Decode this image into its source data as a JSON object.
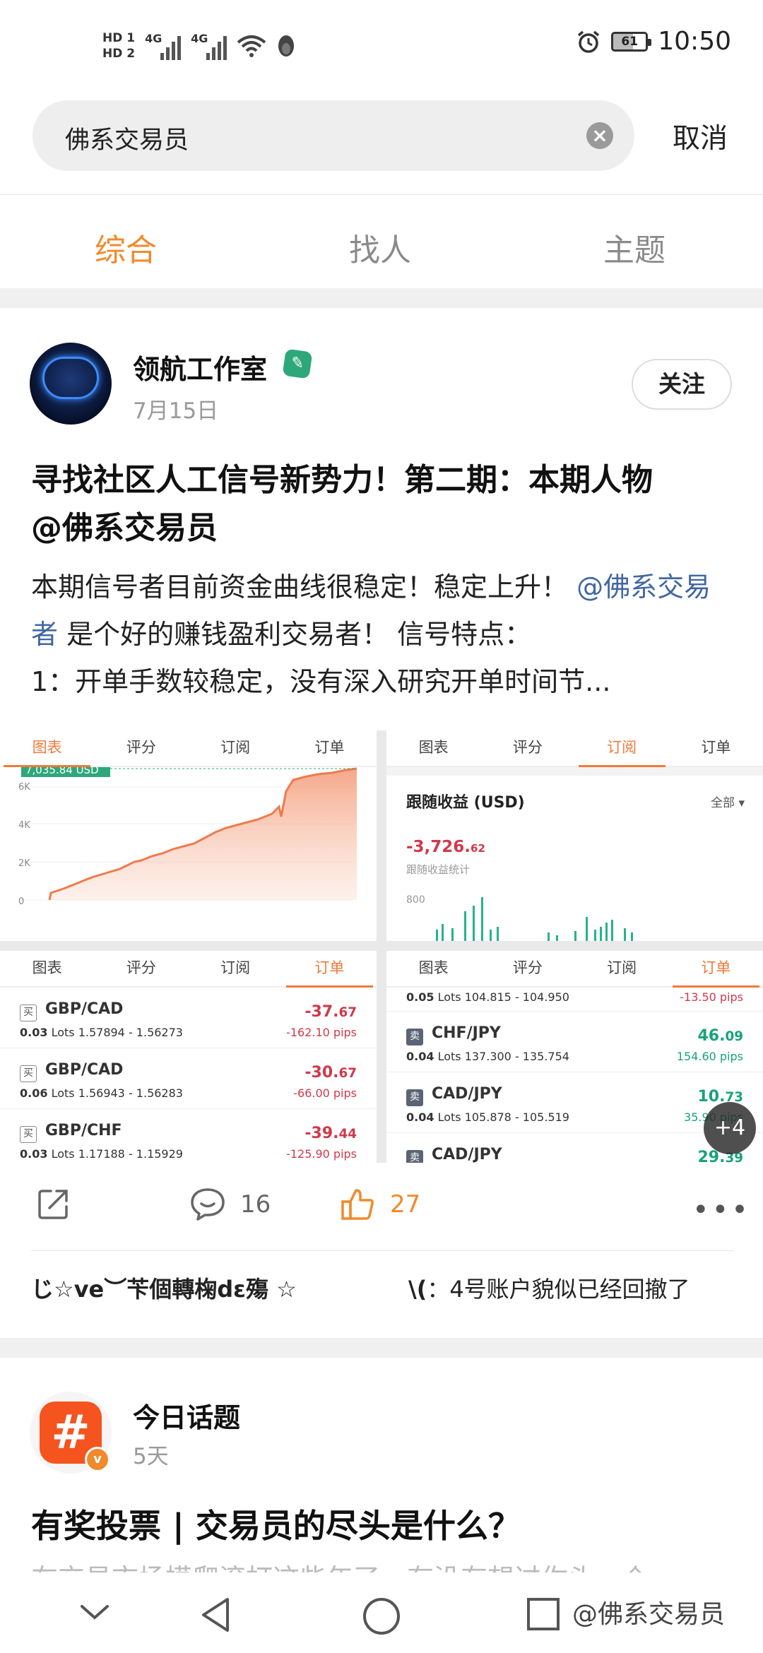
{
  "status_bar": {
    "hd1": "HD 1",
    "hd2": "HD 2",
    "net1": "4G",
    "net2": "4G",
    "battery": "61",
    "time": "10:50"
  },
  "search": {
    "query": "佛系交易员",
    "cancel_label": "取消"
  },
  "tabs": [
    {
      "label": "综合",
      "active": true
    },
    {
      "label": "找人",
      "active": false
    },
    {
      "label": "主题",
      "active": false
    }
  ],
  "post1": {
    "author": "领航工作室",
    "date": "7月15日",
    "follow_label": "关注",
    "title_line1": "寻找社区人工信号新势力！第二期：本期人物",
    "title_line2": "@佛系交易员",
    "body_part1": "本期信号者目前资金曲线很稳定！稳定上升！ ",
    "mention": "@佛系交易者",
    "body_part2": " 是个好的赚钱盈利交易者！ 信号特点：",
    "body_line3": "1：开单手数较稳定，没有深入研究开单时间节...",
    "images": {
      "mini_tabs": [
        "图表",
        "评分",
        "订阅",
        "订单"
      ],
      "chart_tag": "7,035.84 USD",
      "chart_yticks": [
        "6K",
        "4K",
        "2K",
        "0"
      ],
      "follow_title": "跟随收益 (USD)",
      "follow_filter": "全部 ▾",
      "follow_value": "-3,726.",
      "follow_value_dec": "62",
      "follow_sub": "跟随收益统计",
      "follow_ylabel": "800",
      "orders_left": [
        {
          "side": "买",
          "pair": "GBP/CAD",
          "lots": "0.03",
          "range": "Lots  1.57894 - 1.56273",
          "pnl": "-37.",
          "pnl_dec": "67",
          "pips": "-162.10 pips"
        },
        {
          "side": "买",
          "pair": "GBP/CAD",
          "lots": "0.06",
          "range": "Lots  1.56943 - 1.56283",
          "pnl": "-30.",
          "pnl_dec": "67",
          "pips": "-66.00 pips"
        },
        {
          "side": "买",
          "pair": "GBP/CHF",
          "lots": "0.03",
          "range": "Lots  1.17188 - 1.15929",
          "pnl": "-39.",
          "pnl_dec": "44",
          "pips": "-125.90 pips"
        }
      ],
      "orders_right_top": {
        "lots": "0.05",
        "range": "Lots  104.815 - 104.950",
        "pips": "-13.50 pips"
      },
      "orders_right": [
        {
          "side": "卖",
          "pair": "CHF/JPY",
          "lots": "0.04",
          "range": "Lots  137.300 - 135.754",
          "pnl": "46.",
          "pnl_dec": "09",
          "pips": "154.60 pips"
        },
        {
          "side": "卖",
          "pair": "CAD/JPY",
          "lots": "0.04",
          "range": "Lots  105.878 - 105.519",
          "pnl": "10.",
          "pnl_dec": "73",
          "pips": "35.90 pips"
        },
        {
          "side": "卖",
          "pair": "CAD/JPY",
          "lots": "",
          "range": "",
          "pnl": "29.",
          "pnl_dec": "39",
          "pips": ""
        }
      ],
      "more_count": "+4"
    },
    "comments_count": "16",
    "likes_count": "27",
    "top_comments": [
      {
        "user": "じ☆ve︶苄個轉椈dɛ殤 ☆"
      },
      {
        "user": "\\(",
        "text": "：4号账户貌似已经回撤了"
      }
    ]
  },
  "post2": {
    "author": "今日话题",
    "date": "5天",
    "avatar_glyph": "#",
    "badge": "v",
    "title": "有奖投票 | 交易员的尽头是什么？",
    "peek_text": "在交易市场摸爬滚打这些年了，有没有想过你头一个"
  },
  "watermark": "@佛系交易员",
  "colors": {
    "accent": "#f08a2c",
    "mention": "#4066a4",
    "loss": "#d0394a",
    "profit": "#18a37a",
    "chart": "#ef7a4d"
  }
}
